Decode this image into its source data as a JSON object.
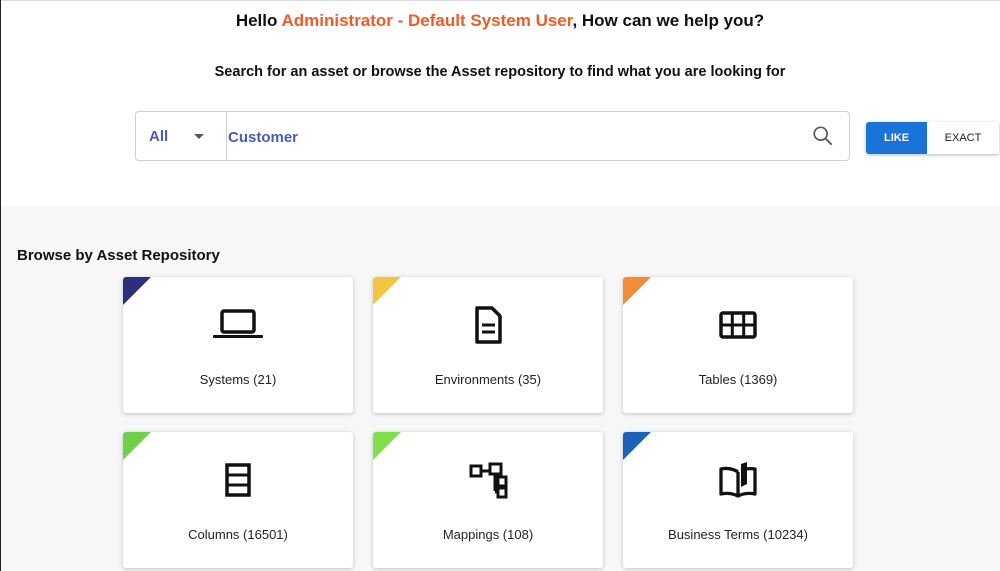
{
  "header": {
    "greeting_prefix": "Hello ",
    "user_name": "Administrator - Default System User",
    "greeting_suffix": ", How can we help you?",
    "subtitle": "Search for an asset or browse the Asset repository to find what you are looking for",
    "user_color": "#f05a28"
  },
  "search": {
    "scope_value": "All",
    "query": "Customer",
    "icon": "search-icon"
  },
  "match_mode": {
    "like_label": "LIKE",
    "exact_label": "EXACT",
    "selected": "LIKE",
    "accent": "#1a73d9"
  },
  "browse": {
    "title": "Browse by Asset Repository",
    "cards": [
      {
        "label": "Systems (21)",
        "icon": "laptop-icon",
        "corner_color": "#2e2e7a"
      },
      {
        "label": "Environments (35)",
        "icon": "document-icon",
        "corner_color": "#f4c542"
      },
      {
        "label": "Tables (1369)",
        "icon": "table-grid-icon",
        "corner_color": "#f28c38"
      },
      {
        "label": "Columns (16501)",
        "icon": "columns-icon",
        "corner_color": "#6fd14a"
      },
      {
        "label": "Mappings (108)",
        "icon": "mapping-tree-icon",
        "corner_color": "#7fe04c"
      },
      {
        "label": "Business Terms (10234)",
        "icon": "book-icon",
        "corner_color": "#1e5fb8"
      }
    ]
  }
}
